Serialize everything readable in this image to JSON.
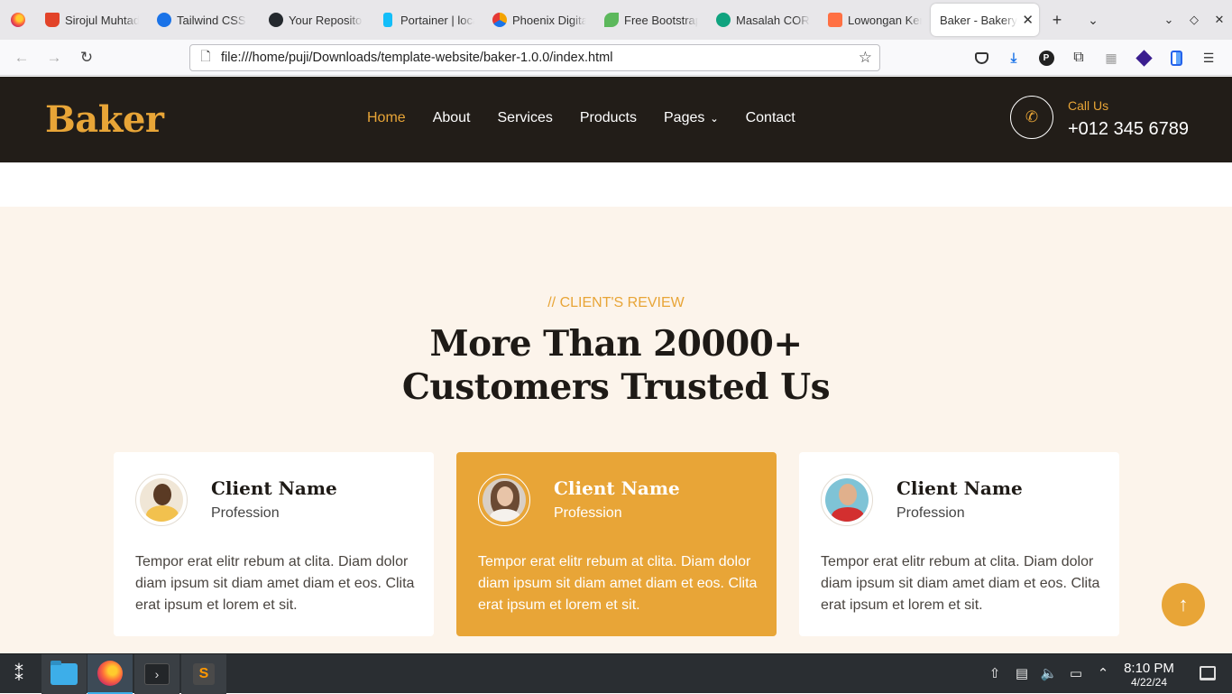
{
  "browser": {
    "tabs": [
      {
        "title": "Sirojul Muhtadi",
        "fav": "#e24329"
      },
      {
        "title": "Tailwind CSS",
        "fav": "#1a73e8"
      },
      {
        "title": "Your Repositories",
        "fav": "#24292e"
      },
      {
        "title": "Portainer | localhost",
        "fav": "#13bef9"
      },
      {
        "title": "Phoenix Digital",
        "fav": "#f4a300"
      },
      {
        "title": "Free Bootstrap",
        "fav": "#5cb85c"
      },
      {
        "title": "Masalah CORS",
        "fav": "#10a37f"
      },
      {
        "title": "Lowongan Kerja",
        "fav": "#ff7043"
      }
    ],
    "active_tab": {
      "title": "Baker - Bakery"
    },
    "new_tab_label": "+",
    "url": "file:///home/puji/Downloads/template-website/baker-1.0.0/index.html"
  },
  "site": {
    "logo": "Baker",
    "menu": [
      "Home",
      "About",
      "Services",
      "Products",
      "Pages",
      "Contact"
    ],
    "call_label": "Call Us",
    "call_number": "+012 345 6789",
    "review": {
      "eyebrow": "// CLIENT'S REVIEW",
      "heading_line1": "More Than 20000+",
      "heading_line2": "Customers Trusted Us",
      "cards": [
        {
          "name": "Client Name",
          "profession": "Profession",
          "text": "Tempor erat elitr rebum at clita. Diam dolor diam ipsum sit diam amet diam et eos. Clita erat ipsum et lorem et sit."
        },
        {
          "name": "Client Name",
          "profession": "Profession",
          "text": "Tempor erat elitr rebum at clita. Diam dolor diam ipsum sit diam amet diam et eos. Clita erat ipsum et lorem et sit."
        },
        {
          "name": "Client Name",
          "profession": "Profession",
          "text": "Tempor erat elitr rebum at clita. Diam dolor diam ipsum sit diam amet diam et eos. Clita erat ipsum et lorem et sit."
        }
      ]
    },
    "colors": {
      "accent": "#e8a537",
      "header_bg": "#221d18",
      "section_bg": "#fcf4eb"
    }
  },
  "taskbar": {
    "time": "8:10 PM",
    "date": "4/22/24"
  }
}
